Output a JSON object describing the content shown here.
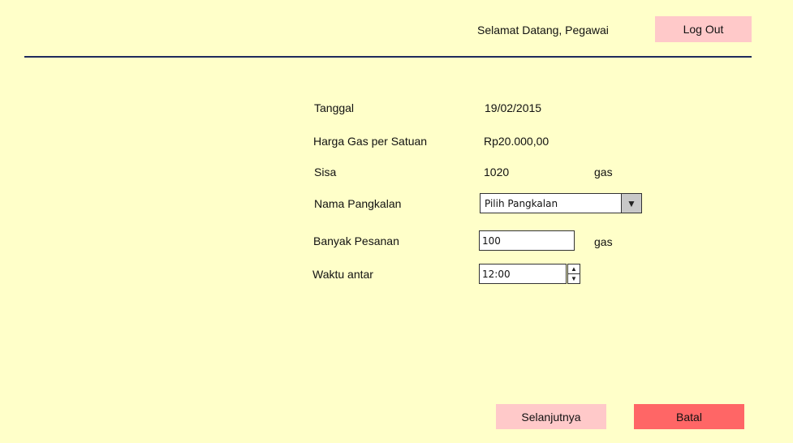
{
  "header": {
    "welcome_text": "Selamat Datang, Pegawai",
    "logout_label": "Log Out"
  },
  "form": {
    "tanggal": {
      "label": "Tanggal",
      "value": "19/02/2015"
    },
    "harga": {
      "label": "Harga Gas per Satuan",
      "value": "Rp20.000,00"
    },
    "sisa": {
      "label": "Sisa",
      "value": "1020",
      "unit": "gas"
    },
    "nama_pangkalan": {
      "label": "Nama Pangkalan",
      "selected": "Pilih Pangkalan"
    },
    "banyak_pesanan": {
      "label": "Banyak Pesanan",
      "value": "100",
      "unit": "gas"
    },
    "waktu_antar": {
      "label": "Waktu antar",
      "value": "12:00"
    }
  },
  "footer": {
    "next_label": "Selanjutnya",
    "cancel_label": "Batal"
  },
  "colors": {
    "background": "#ffffc9",
    "button_light": "#ffc9c9",
    "button_danger": "#ff6666",
    "divider": "#1f2a5c"
  },
  "icons": {
    "dropdown": "triangle-down-icon",
    "spinner_up": "chevron-up-icon",
    "spinner_down": "chevron-down-icon"
  }
}
